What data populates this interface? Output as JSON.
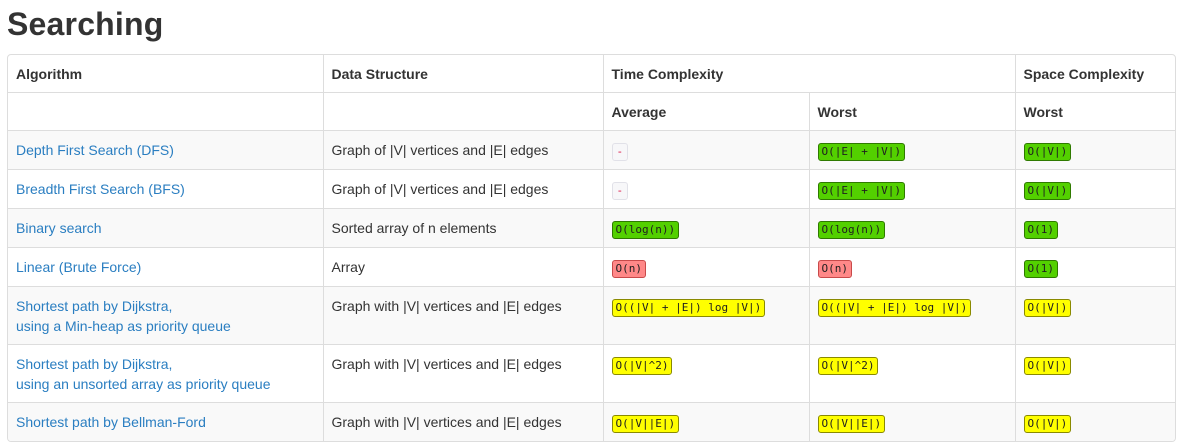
{
  "page_title": "Searching",
  "colors": {
    "good": "#53d000",
    "fair": "#ffff00",
    "bad": "#ff8888",
    "link": "#2a7ec1"
  },
  "headers": {
    "algorithm": "Algorithm",
    "data_structure": "Data Structure",
    "time_complexity": "Time Complexity",
    "space_complexity": "Space Complexity",
    "average": "Average",
    "worst": "Worst",
    "space_worst": "Worst"
  },
  "rows": [
    {
      "algo_line1": "Depth First Search (DFS)",
      "algo_line2": "",
      "structure": "Graph of |V| vertices and |E| edges",
      "average": {
        "text": "-",
        "level": "gray"
      },
      "worst": {
        "text": "O(|E| + |V|)",
        "level": "green"
      },
      "space": {
        "text": "O(|V|)",
        "level": "green"
      }
    },
    {
      "algo_line1": "Breadth First Search (BFS)",
      "algo_line2": "",
      "structure": "Graph of |V| vertices and |E| edges",
      "average": {
        "text": "-",
        "level": "gray"
      },
      "worst": {
        "text": "O(|E| + |V|)",
        "level": "green"
      },
      "space": {
        "text": "O(|V|)",
        "level": "green"
      }
    },
    {
      "algo_line1": "Binary search",
      "algo_line2": "",
      "structure": "Sorted array of n elements",
      "average": {
        "text": "O(log(n))",
        "level": "green"
      },
      "worst": {
        "text": "O(log(n))",
        "level": "green"
      },
      "space": {
        "text": "O(1)",
        "level": "green"
      }
    },
    {
      "algo_line1": "Linear (Brute Force)",
      "algo_line2": "",
      "structure": "Array",
      "average": {
        "text": "O(n)",
        "level": "red"
      },
      "worst": {
        "text": "O(n)",
        "level": "red"
      },
      "space": {
        "text": "O(1)",
        "level": "green"
      }
    },
    {
      "algo_line1": "Shortest path by Dijkstra,",
      "algo_line2": "using a Min-heap as priority queue",
      "structure": "Graph with |V| vertices and |E| edges",
      "average": {
        "text": "O((|V| + |E|) log |V|)",
        "level": "yellow"
      },
      "worst": {
        "text": "O((|V| + |E|) log |V|)",
        "level": "yellow"
      },
      "space": {
        "text": "O(|V|)",
        "level": "yellow"
      }
    },
    {
      "algo_line1": "Shortest path by Dijkstra,",
      "algo_line2": "using an unsorted array as priority queue",
      "structure": "Graph with |V| vertices and |E| edges",
      "average": {
        "text": "O(|V|^2)",
        "level": "yellow"
      },
      "worst": {
        "text": "O(|V|^2)",
        "level": "yellow"
      },
      "space": {
        "text": "O(|V|)",
        "level": "yellow"
      }
    },
    {
      "algo_line1": "Shortest path by Bellman-Ford",
      "algo_line2": "",
      "structure": "Graph with |V| vertices and |E| edges",
      "average": {
        "text": "O(|V||E|)",
        "level": "yellow"
      },
      "worst": {
        "text": "O(|V||E|)",
        "level": "yellow"
      },
      "space": {
        "text": "O(|V|)",
        "level": "yellow"
      }
    }
  ]
}
